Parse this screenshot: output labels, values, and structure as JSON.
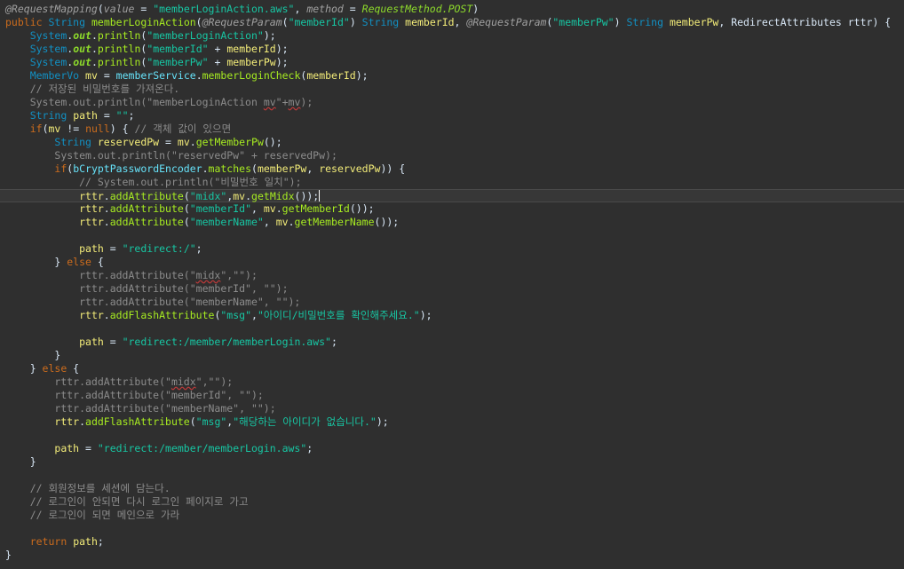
{
  "editor": {
    "language": "java",
    "current_line": 14,
    "colors": {
      "background": "#2f2f2f",
      "annotation": "#a0a0a0",
      "keyword": "#cc6c1d",
      "type": "#1290c3",
      "method": "#a7ec21",
      "string": "#17c6a3",
      "comment": "#8c8c8c",
      "field": "#66e1f8",
      "local": "#f3ec79",
      "static_field": "#8dda2b",
      "text": "#d9e8f7"
    },
    "lines": [
      [
        [
          "ann",
          "@RequestMapping"
        ],
        [
          "plain",
          "("
        ],
        [
          "ann",
          "value"
        ],
        [
          "plain",
          " = "
        ],
        [
          "str",
          "\"memberLoginAction.aws\""
        ],
        [
          "plain",
          ", "
        ],
        [
          "ann",
          "method"
        ],
        [
          "plain",
          " = "
        ],
        [
          "const",
          "RequestMethod.POST"
        ],
        [
          "plain",
          ")"
        ]
      ],
      [
        [
          "key",
          "public"
        ],
        [
          "plain",
          " "
        ],
        [
          "type",
          "String"
        ],
        [
          "plain",
          " "
        ],
        [
          "fn",
          "memberLoginAction"
        ],
        [
          "plain",
          "("
        ],
        [
          "ann",
          "@RequestParam"
        ],
        [
          "plain",
          "("
        ],
        [
          "str",
          "\"memberId\""
        ],
        [
          "plain",
          ") "
        ],
        [
          "type",
          "String"
        ],
        [
          "plain",
          " "
        ],
        [
          "loc",
          "memberId"
        ],
        [
          "plain",
          ", "
        ],
        [
          "ann",
          "@RequestParam"
        ],
        [
          "plain",
          "("
        ],
        [
          "str",
          "\"memberPw\""
        ],
        [
          "plain",
          ") "
        ],
        [
          "type",
          "String"
        ],
        [
          "plain",
          " "
        ],
        [
          "loc",
          "memberPw"
        ],
        [
          "plain",
          ", "
        ],
        [
          "plain",
          "RedirectAttributes rttr) {"
        ]
      ],
      [
        [
          "plain",
          "    "
        ],
        [
          "type",
          "System"
        ],
        [
          "plain",
          "."
        ],
        [
          "sfld",
          "out"
        ],
        [
          "plain",
          "."
        ],
        [
          "fn",
          "println"
        ],
        [
          "plain",
          "("
        ],
        [
          "str",
          "\"memberLoginAction\""
        ],
        [
          "plain",
          ");"
        ]
      ],
      [
        [
          "plain",
          "    "
        ],
        [
          "type",
          "System"
        ],
        [
          "plain",
          "."
        ],
        [
          "sfld",
          "out"
        ],
        [
          "plain",
          "."
        ],
        [
          "fn",
          "println"
        ],
        [
          "plain",
          "("
        ],
        [
          "str",
          "\"memberId\""
        ],
        [
          "plain",
          " + "
        ],
        [
          "loc",
          "memberId"
        ],
        [
          "plain",
          ");"
        ]
      ],
      [
        [
          "plain",
          "    "
        ],
        [
          "type",
          "System"
        ],
        [
          "plain",
          "."
        ],
        [
          "sfld",
          "out"
        ],
        [
          "plain",
          "."
        ],
        [
          "fn",
          "println"
        ],
        [
          "plain",
          "("
        ],
        [
          "str",
          "\"memberPw\""
        ],
        [
          "plain",
          " + "
        ],
        [
          "loc",
          "memberPw"
        ],
        [
          "plain",
          ");"
        ]
      ],
      [
        [
          "plain",
          "    "
        ],
        [
          "type",
          "MemberVo"
        ],
        [
          "plain",
          " "
        ],
        [
          "loc",
          "mv"
        ],
        [
          "plain",
          " = "
        ],
        [
          "var",
          "memberService"
        ],
        [
          "plain",
          "."
        ],
        [
          "fn",
          "memberLoginCheck"
        ],
        [
          "plain",
          "("
        ],
        [
          "loc",
          "memberId"
        ],
        [
          "plain",
          ");"
        ]
      ],
      [
        [
          "plain",
          "    "
        ],
        [
          "cmt",
          "// 저장된 비밀번호를 가져온다."
        ]
      ],
      [
        [
          "plain",
          "    "
        ],
        [
          "cmt",
          "System.out.println(\"memberLoginAction "
        ],
        [
          "warn",
          "mv"
        ],
        [
          "cmt",
          "\"+"
        ],
        [
          "warn",
          "mv"
        ],
        [
          "cmt",
          ");"
        ]
      ],
      [
        [
          "plain",
          "    "
        ],
        [
          "type",
          "String"
        ],
        [
          "plain",
          " "
        ],
        [
          "loc",
          "path"
        ],
        [
          "plain",
          " = "
        ],
        [
          "str",
          "\"\""
        ],
        [
          "plain",
          ";"
        ]
      ],
      [
        [
          "plain",
          "    "
        ],
        [
          "key",
          "if"
        ],
        [
          "plain",
          "("
        ],
        [
          "loc",
          "mv"
        ],
        [
          "plain",
          " != "
        ],
        [
          "key",
          "null"
        ],
        [
          "plain",
          ") { "
        ],
        [
          "cmt",
          "// 객체 값이 있으면"
        ]
      ],
      [
        [
          "plain",
          "        "
        ],
        [
          "type",
          "String"
        ],
        [
          "plain",
          " "
        ],
        [
          "loc",
          "reservedPw"
        ],
        [
          "plain",
          " = "
        ],
        [
          "loc",
          "mv"
        ],
        [
          "plain",
          "."
        ],
        [
          "fn",
          "getMemberPw"
        ],
        [
          "plain",
          "();"
        ]
      ],
      [
        [
          "plain",
          "        "
        ],
        [
          "cmt",
          "System.out.println(\"reservedPw\" + reservedPw);"
        ]
      ],
      [
        [
          "plain",
          "        "
        ],
        [
          "key",
          "if"
        ],
        [
          "plain",
          "("
        ],
        [
          "var",
          "bCryptPasswordEncoder"
        ],
        [
          "plain",
          "."
        ],
        [
          "fn",
          "matches"
        ],
        [
          "plain",
          "("
        ],
        [
          "loc",
          "memberPw"
        ],
        [
          "plain",
          ", "
        ],
        [
          "loc",
          "reservedPw"
        ],
        [
          "plain",
          ")) {"
        ]
      ],
      [
        [
          "plain",
          "            "
        ],
        [
          "cmt",
          "// System.out.println(\"비밀번호 일치\");"
        ]
      ],
      [
        [
          "plain",
          "            "
        ],
        [
          "loc",
          "rttr"
        ],
        [
          "plain",
          "."
        ],
        [
          "fn",
          "addAttribute"
        ],
        [
          "plain",
          "("
        ],
        [
          "str",
          "\"midx\""
        ],
        [
          "plain",
          ","
        ],
        [
          "loc",
          "mv"
        ],
        [
          "plain",
          "."
        ],
        [
          "fn",
          "getMidx"
        ],
        [
          "plain",
          "());"
        ],
        [
          "caret",
          ""
        ]
      ],
      [
        [
          "plain",
          "            "
        ],
        [
          "loc",
          "rttr"
        ],
        [
          "plain",
          "."
        ],
        [
          "fn",
          "addAttribute"
        ],
        [
          "plain",
          "("
        ],
        [
          "str",
          "\"memberId\""
        ],
        [
          "plain",
          ", "
        ],
        [
          "loc",
          "mv"
        ],
        [
          "plain",
          "."
        ],
        [
          "fn",
          "getMemberId"
        ],
        [
          "plain",
          "());"
        ]
      ],
      [
        [
          "plain",
          "            "
        ],
        [
          "loc",
          "rttr"
        ],
        [
          "plain",
          "."
        ],
        [
          "fn",
          "addAttribute"
        ],
        [
          "plain",
          "("
        ],
        [
          "str",
          "\"memberName\""
        ],
        [
          "plain",
          ", "
        ],
        [
          "loc",
          "mv"
        ],
        [
          "plain",
          "."
        ],
        [
          "fn",
          "getMemberName"
        ],
        [
          "plain",
          "());"
        ]
      ],
      [],
      [
        [
          "plain",
          "            "
        ],
        [
          "loc",
          "path"
        ],
        [
          "plain",
          " = "
        ],
        [
          "str",
          "\"redirect:/\""
        ],
        [
          "plain",
          ";"
        ]
      ],
      [
        [
          "plain",
          "        } "
        ],
        [
          "key",
          "else"
        ],
        [
          "plain",
          " {"
        ]
      ],
      [
        [
          "plain",
          "            "
        ],
        [
          "cmt",
          "rttr.addAttribute(\""
        ],
        [
          "warn",
          "midx"
        ],
        [
          "cmt",
          "\",\"\");"
        ]
      ],
      [
        [
          "plain",
          "            "
        ],
        [
          "cmt",
          "rttr.addAttribute(\"memberId\", \"\");"
        ]
      ],
      [
        [
          "plain",
          "            "
        ],
        [
          "cmt",
          "rttr.addAttribute(\"memberName\", \"\");"
        ]
      ],
      [
        [
          "plain",
          "            "
        ],
        [
          "loc",
          "rttr"
        ],
        [
          "plain",
          "."
        ],
        [
          "fn",
          "addFlashAttribute"
        ],
        [
          "plain",
          "("
        ],
        [
          "str",
          "\"msg\""
        ],
        [
          "plain",
          ","
        ],
        [
          "str",
          "\"아이디/비밀번호를 확인해주세요.\""
        ],
        [
          "plain",
          ");"
        ]
      ],
      [],
      [
        [
          "plain",
          "            "
        ],
        [
          "loc",
          "path"
        ],
        [
          "plain",
          " = "
        ],
        [
          "str",
          "\"redirect:/member/memberLogin.aws\""
        ],
        [
          "plain",
          ";"
        ]
      ],
      [
        [
          "plain",
          "        }"
        ]
      ],
      [
        [
          "plain",
          "    } "
        ],
        [
          "key",
          "else"
        ],
        [
          "plain",
          " {"
        ]
      ],
      [
        [
          "plain",
          "        "
        ],
        [
          "cmt",
          "rttr.addAttribute(\""
        ],
        [
          "warn",
          "midx"
        ],
        [
          "cmt",
          "\",\"\");"
        ]
      ],
      [
        [
          "plain",
          "        "
        ],
        [
          "cmt",
          "rttr.addAttribute(\"memberId\", \"\");"
        ]
      ],
      [
        [
          "plain",
          "        "
        ],
        [
          "cmt",
          "rttr.addAttribute(\"memberName\", \"\");"
        ]
      ],
      [
        [
          "plain",
          "        "
        ],
        [
          "loc",
          "rttr"
        ],
        [
          "plain",
          "."
        ],
        [
          "fn",
          "addFlashAttribute"
        ],
        [
          "plain",
          "("
        ],
        [
          "str",
          "\"msg\""
        ],
        [
          "plain",
          ","
        ],
        [
          "str",
          "\"해당하는 아이디가 없습니다.\""
        ],
        [
          "plain",
          ");"
        ]
      ],
      [],
      [
        [
          "plain",
          "        "
        ],
        [
          "loc",
          "path"
        ],
        [
          "plain",
          " = "
        ],
        [
          "str",
          "\"redirect:/member/memberLogin.aws\""
        ],
        [
          "plain",
          ";"
        ]
      ],
      [
        [
          "plain",
          "    }"
        ]
      ],
      [],
      [
        [
          "plain",
          "    "
        ],
        [
          "cmt",
          "// 회원정보를 세션에 담는다."
        ]
      ],
      [
        [
          "plain",
          "    "
        ],
        [
          "cmt",
          "// 로그인이 안되면 다시 로그인 페이지로 가고"
        ]
      ],
      [
        [
          "plain",
          "    "
        ],
        [
          "cmt",
          "// 로그인이 되면 메인으로 가라"
        ]
      ],
      [],
      [
        [
          "plain",
          "    "
        ],
        [
          "key",
          "return"
        ],
        [
          "plain",
          " "
        ],
        [
          "loc",
          "path"
        ],
        [
          "plain",
          ";"
        ]
      ],
      [
        [
          "plain",
          "}"
        ]
      ]
    ]
  }
}
